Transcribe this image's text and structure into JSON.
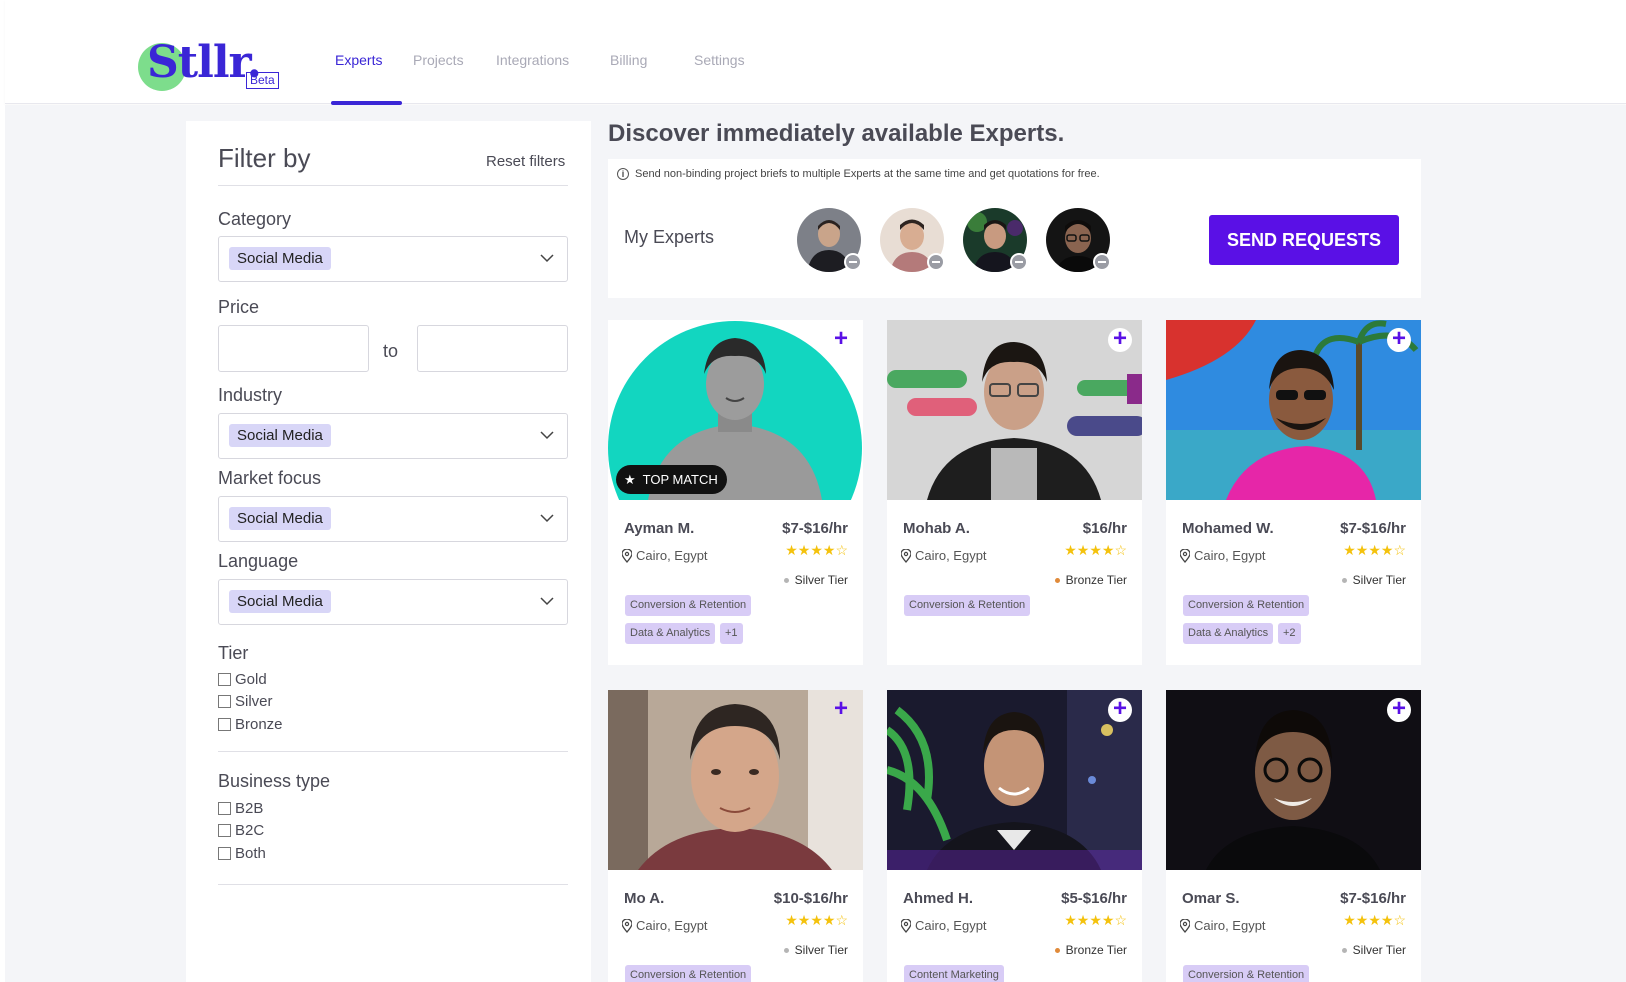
{
  "brand": {
    "logo_text": "Stllr",
    "logo_dot": ".",
    "beta": "Beta"
  },
  "nav": [
    {
      "label": "Experts",
      "active": true
    },
    {
      "label": "Projects"
    },
    {
      "label": "Integrations"
    },
    {
      "label": "Billing"
    },
    {
      "label": "Settings"
    }
  ],
  "filters": {
    "title": "Filter by",
    "reset": "Reset filters",
    "category": {
      "label": "Category",
      "value": "Social Media"
    },
    "price": {
      "label": "Price",
      "to": "to",
      "min": "",
      "max": ""
    },
    "industry": {
      "label": "Industry",
      "value": "Social Media"
    },
    "market_focus": {
      "label": "Market focus",
      "value": "Social Media"
    },
    "language": {
      "label": "Language",
      "value": "Social Media"
    },
    "tier": {
      "label": "Tier",
      "options": [
        "Gold",
        "Silver",
        "Bronze"
      ]
    },
    "business_type": {
      "label": "Business type",
      "options": [
        "B2B",
        "B2C",
        "Both"
      ]
    }
  },
  "main": {
    "title": "Discover immediately available Experts.",
    "info": "Send non-binding project briefs to multiple Experts at the same time and get quotations for free.",
    "my_experts": "My Experts",
    "send_requests": "SEND REQUESTS"
  },
  "colors": {
    "accent": "#5a10e6",
    "brand": "#3a26d6",
    "star": "#f4c20d",
    "silver": "#b5b5b5",
    "bronze": "#e08a3a"
  },
  "experts": [
    {
      "name": "Ayman M.",
      "price": "$7-$16/hr",
      "location": "Cairo, Egypt",
      "rating": 4,
      "tier": "Silver Tier",
      "tags": [
        "Conversion & Retention",
        "Data & Analytics",
        "+1"
      ],
      "badge": "TOP MATCH"
    },
    {
      "name": "Mohab A.",
      "price": "$16/hr",
      "location": "Cairo, Egypt",
      "rating": 4,
      "tier": "Bronze Tier",
      "tags": [
        "Conversion & Retention"
      ]
    },
    {
      "name": "Mohamed W.",
      "price": "$7-$16/hr",
      "location": "Cairo, Egypt",
      "rating": 4,
      "tier": "Silver Tier",
      "tags": [
        "Conversion & Retention",
        "Data & Analytics",
        "+2"
      ]
    },
    {
      "name": "Mo A.",
      "price": "$10-$16/hr",
      "location": "Cairo, Egypt",
      "rating": 4,
      "tier": "Silver Tier",
      "tags": [
        "Conversion & Retention"
      ]
    },
    {
      "name": "Ahmed H.",
      "price": "$5-$16/hr",
      "location": "Cairo, Egypt",
      "rating": 4,
      "tier": "Bronze Tier",
      "tags": [
        "Content Marketing"
      ]
    },
    {
      "name": "Omar S.",
      "price": "$7-$16/hr",
      "location": "Cairo, Egypt",
      "rating": 4,
      "tier": "Silver Tier",
      "tags": [
        "Conversion & Retention"
      ]
    }
  ],
  "icons": {
    "add": "plus-icon",
    "pin": "location-pin-icon",
    "chevron": "chevron-down-icon",
    "info": "info-icon",
    "star": "star-icon"
  }
}
